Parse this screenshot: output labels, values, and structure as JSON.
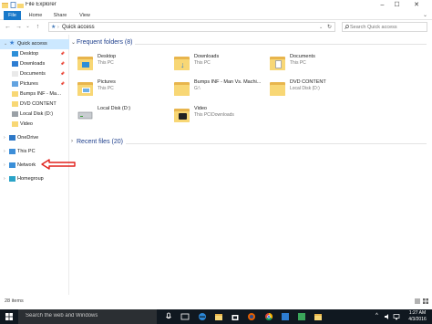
{
  "window": {
    "title": "File Explorer",
    "minimize": "–",
    "maximize": "☐",
    "close": "✕"
  },
  "ribbon": {
    "tabs": [
      "File",
      "Home",
      "Share",
      "View"
    ]
  },
  "address": {
    "back": "←",
    "forward": "→",
    "up": "↑",
    "breadcrumb": "Quick access",
    "search_placeholder": "Search Quick access"
  },
  "nav_pane": {
    "items": [
      {
        "label": "Quick access",
        "icon": "star-icon",
        "pinned": false,
        "chevron": "⌄",
        "selected": true
      },
      {
        "label": "Desktop",
        "icon": "desktop-icon",
        "pinned": true
      },
      {
        "label": "Downloads",
        "icon": "download-icon",
        "pinned": true
      },
      {
        "label": "Documents",
        "icon": "documents-icon",
        "pinned": true
      },
      {
        "label": "Pictures",
        "icon": "pictures-icon",
        "pinned": true
      },
      {
        "label": "Bumps INF - Man V",
        "icon": "folder-icon",
        "pinned": false
      },
      {
        "label": "DVD CONTENT",
        "icon": "folder-icon",
        "pinned": false
      },
      {
        "label": "Local Disk (D:)",
        "icon": "drive-icon",
        "pinned": false
      },
      {
        "label": "Video",
        "icon": "folder-icon",
        "pinned": false
      },
      {
        "label": "OneDrive",
        "icon": "onedrive-icon",
        "chevron": "›"
      },
      {
        "label": "This PC",
        "icon": "pc-icon",
        "chevron": "›"
      },
      {
        "label": "Network",
        "icon": "network-icon",
        "chevron": "›"
      },
      {
        "label": "Homegroup",
        "icon": "homegroup-icon",
        "chevron": "›"
      }
    ]
  },
  "content": {
    "frequent_header": "Frequent folders (8)",
    "recent_header": "Recent files (20)",
    "chevron_open": "⌄",
    "chevron_closed": "›",
    "folders": [
      {
        "name": "Desktop",
        "sub": "This PC",
        "icon": "desktop-folder-icon"
      },
      {
        "name": "Downloads",
        "sub": "This PC",
        "icon": "download-folder-icon"
      },
      {
        "name": "Documents",
        "sub": "This PC",
        "icon": "documents-folder-icon"
      },
      {
        "name": "Pictures",
        "sub": "This PC",
        "icon": "pictures-folder-icon"
      },
      {
        "name": "Bumps INF - Man Vs. Machi...",
        "sub": "G:\\",
        "icon": "folder-icon"
      },
      {
        "name": "DVD CONTENT",
        "sub": "Local Disk (D:)",
        "icon": "folder-icon"
      },
      {
        "name": "Local Disk (D:)",
        "sub": "",
        "icon": "drive-icon"
      },
      {
        "name": "Video",
        "sub": "This PC\\Downloads",
        "icon": "folder-icon"
      }
    ]
  },
  "status": {
    "items": "28 items"
  },
  "taskbar": {
    "search": "Search the web and Windows",
    "time": "1:27 AM",
    "date": "4/3/2016"
  },
  "colors": {
    "accent": "#1979ca",
    "selected": "#cce8ff",
    "group_header": "#1e3f8c",
    "annotation_arrow": "#e0201b"
  }
}
